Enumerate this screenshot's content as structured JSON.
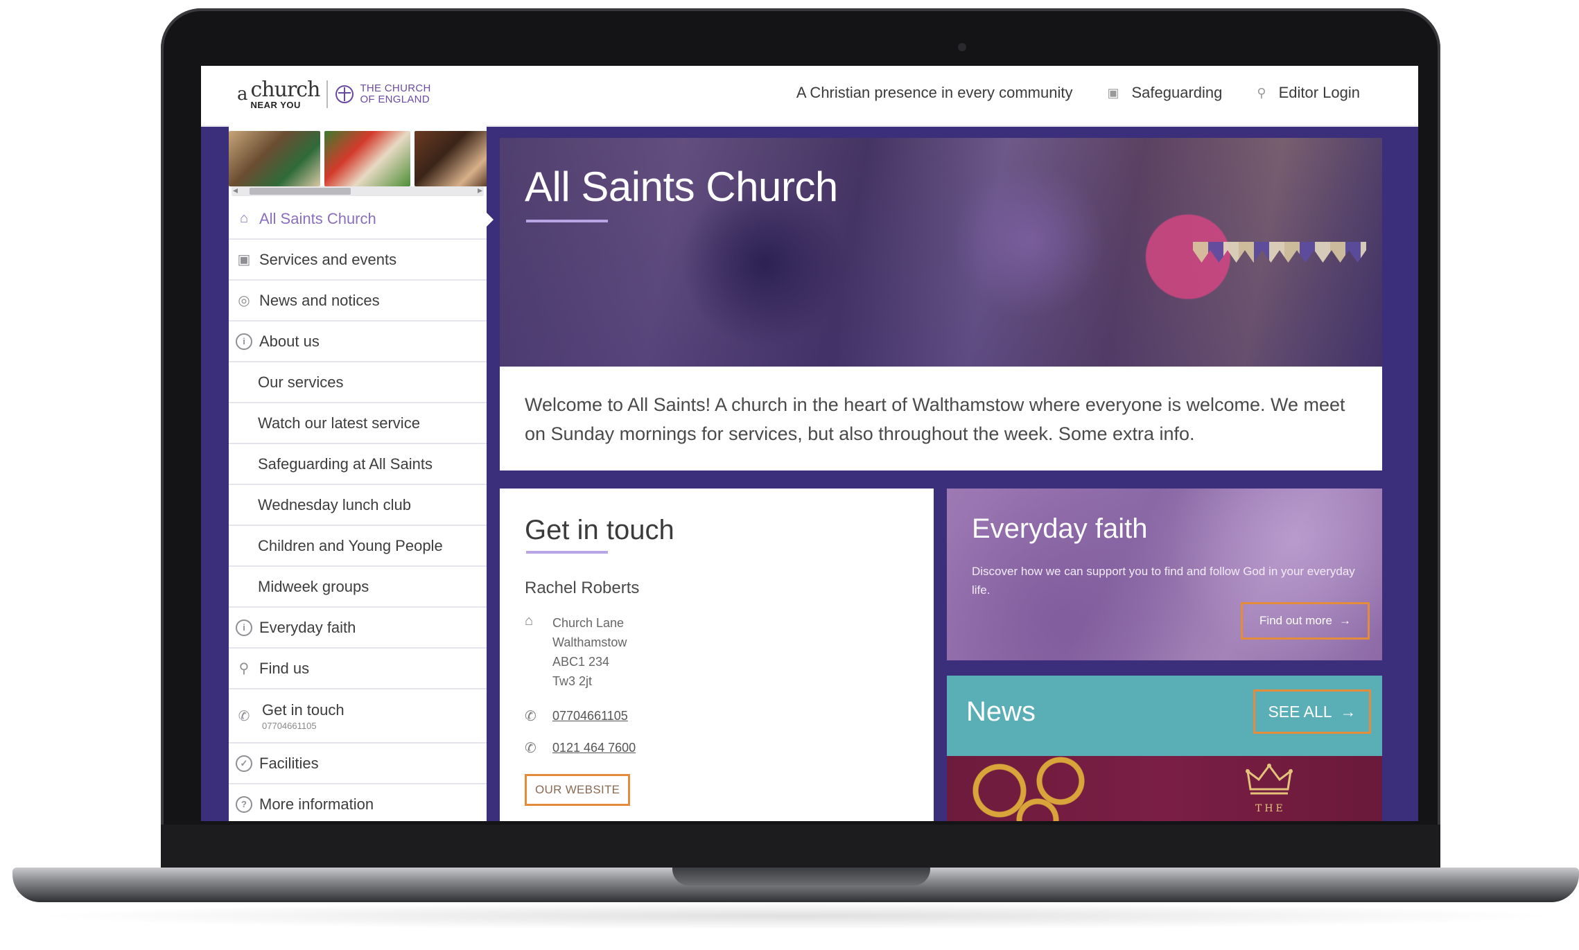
{
  "header": {
    "logo_a": "a",
    "logo_church": "church",
    "logo_near": "NEAR YOU",
    "logo_coe_line1": "THE CHURCH",
    "logo_coe_line2": "OF ENGLAND",
    "tagline": "A Christian presence in every community",
    "safeguarding": "Safeguarding",
    "editor_login": "Editor Login"
  },
  "sidebar": {
    "items": [
      {
        "label": "All Saints Church",
        "icon": "home-icon"
      },
      {
        "label": "Services and events",
        "icon": "calendar-icon"
      },
      {
        "label": "News and notices",
        "icon": "broadcast-icon"
      },
      {
        "label": "About us",
        "icon": "info-icon"
      },
      {
        "label": "Our services"
      },
      {
        "label": "Watch our latest service"
      },
      {
        "label": "Safeguarding at All Saints"
      },
      {
        "label": "Wednesday lunch club"
      },
      {
        "label": "Children and Young People"
      },
      {
        "label": "Midweek groups"
      },
      {
        "label": "Everyday faith",
        "icon": "info-icon"
      },
      {
        "label": "Find us",
        "icon": "pin-icon"
      },
      {
        "label": "Get in touch",
        "sub": "07704661105",
        "icon": "phone-icon"
      },
      {
        "label": "Facilities",
        "icon": "check-circle-icon"
      },
      {
        "label": "More information",
        "icon": "question-icon"
      }
    ]
  },
  "hero": {
    "title": "All Saints Church"
  },
  "welcome": {
    "text": "Welcome to All Saints! A church in the heart of Walthamstow where everyone is welcome. We meet on Sunday mornings for services, but also throughout the week. Some extra info."
  },
  "contact": {
    "title": "Get in touch",
    "name": "Rachel Roberts",
    "address": [
      "Church Lane",
      "Walthamstow",
      "ABC1 234",
      "Tw3 2jt"
    ],
    "phone1": "07704661105",
    "phone2": "0121 464 7600",
    "website_label": "OUR WEBSITE"
  },
  "faith": {
    "title": "Everyday faith",
    "text": "Discover how we can support you to find and follow God in your everyday life.",
    "button": "Find out more"
  },
  "news": {
    "title": "News",
    "button": "SEE ALL",
    "image_text": "THE"
  },
  "colors": {
    "brand_purple": "#3b2f7c",
    "accent_lilac": "#8a6fc0",
    "button_orange": "#e58b3c",
    "news_teal": "#5aaeb6"
  }
}
